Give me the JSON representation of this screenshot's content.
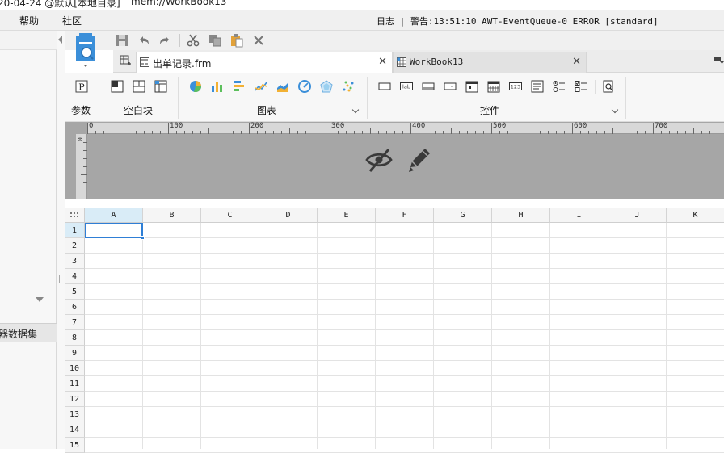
{
  "window": {
    "title_date": "20-04-24 @默认[本地目录]",
    "title_file": "mem://WorkBook13"
  },
  "menu": {
    "items": [
      "帮助",
      "社区"
    ],
    "log_status": "日志 | 警告:13:51:10 AWT-EventQueue-0 ERROR [standard]"
  },
  "left_panel": {
    "bottom_tab": "器数据集"
  },
  "tabs": [
    {
      "label": "出单记录.frm",
      "active": true
    },
    {
      "label": "WorkBook13",
      "active": false
    }
  ],
  "tab_close_glyph": "✕",
  "ribbon": {
    "groups": [
      {
        "label": "参数",
        "icons": [
          "parameter-icon"
        ]
      },
      {
        "label": "空白块",
        "icons": [
          "absolute-layout-icon",
          "split-layout-icon",
          "tab-layout-icon"
        ]
      },
      {
        "label": "图表",
        "icons": [
          "pie-chart-icon",
          "bar-chart-icon",
          "horizontal-bar-icon",
          "line-chart-icon",
          "area-chart-icon",
          "gauge-chart-icon",
          "radar-chart-icon",
          "scatter-chart-icon"
        ]
      },
      {
        "label": "控件",
        "icons": [
          "button-widget-icon",
          "label-widget-icon",
          "text-field-icon",
          "combo-box-icon",
          "date-widget-icon",
          "calendar-icon",
          "number-widget-icon",
          "textarea-icon",
          "radio-group-icon",
          "checkbox-group-icon",
          "search-query-icon"
        ]
      }
    ],
    "number_widget_text": "123",
    "label_widget_text": "lab"
  },
  "ruler": {
    "labels": [
      "0",
      "100",
      "200",
      "300",
      "400",
      "500",
      "600",
      "700"
    ],
    "vlabel": "0"
  },
  "canvas_icons": [
    "hide-icon",
    "edit-icon"
  ],
  "sheet": {
    "columns": [
      "A",
      "B",
      "C",
      "D",
      "E",
      "F",
      "G",
      "H",
      "I",
      "J",
      "K"
    ],
    "rows": [
      "1",
      "2",
      "3",
      "4",
      "5",
      "6",
      "7",
      "8",
      "9",
      "10",
      "11",
      "12",
      "13",
      "14",
      "15"
    ],
    "selected_cell": "A1"
  },
  "colors": {
    "accent": "#2f7fd6",
    "selected_header": "#d9ecf7",
    "canvas_gray": "#a6a6a6"
  }
}
